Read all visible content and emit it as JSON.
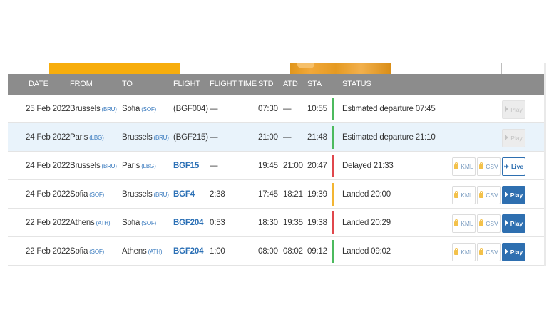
{
  "headers": [
    "DATE",
    "FROM",
    "TO",
    "FLIGHT",
    "FLIGHT TIME",
    "STD",
    "ATD",
    "STA",
    "STATUS"
  ],
  "rows": [
    {
      "date": "25 Feb 2022",
      "from": "Brussels",
      "from_code": "(BRU)",
      "to": "Sofia",
      "to_code": "(SOF)",
      "flight": "(BGF004)",
      "flight_link": false,
      "flight_time": "—",
      "std": "07:30",
      "atd": "—",
      "sta": "10:55",
      "status": "Estimated departure 07:45",
      "status_color": "#4cba5e",
      "kml": "",
      "csv": "",
      "action": "Play",
      "action_type": "disabled",
      "highlight": false
    },
    {
      "date": "24 Feb 2022",
      "from": "Paris",
      "from_code": "(LBG)",
      "to": "Brussels",
      "to_code": "(BRU)",
      "flight": "(BGF215)",
      "flight_link": false,
      "flight_time": "—",
      "std": "21:00",
      "atd": "—",
      "sta": "21:48",
      "status": "Estimated departure 21:10",
      "status_color": "#4cba5e",
      "kml": "",
      "csv": "",
      "action": "Play",
      "action_type": "disabled",
      "highlight": true
    },
    {
      "date": "24 Feb 2022",
      "from": "Brussels",
      "from_code": "(BRU)",
      "to": "Paris",
      "to_code": "(LBG)",
      "flight": "BGF15",
      "flight_link": true,
      "flight_time": "—",
      "std": "19:45",
      "atd": "21:00",
      "sta": "20:47",
      "status": "Delayed 21:33",
      "status_color": "#e0474c",
      "kml": "KML",
      "csv": "CSV",
      "action": "Live",
      "action_type": "live",
      "highlight": false
    },
    {
      "date": "24 Feb 2022",
      "from": "Sofia",
      "from_code": "(SOF)",
      "to": "Brussels",
      "to_code": "(BRU)",
      "flight": "BGF4",
      "flight_link": true,
      "flight_time": "2:38",
      "std": "17:45",
      "atd": "18:21",
      "sta": "19:39",
      "status": "Landed 20:00",
      "status_color": "#f3b532",
      "kml": "KML",
      "csv": "CSV",
      "action": "Play",
      "action_type": "play",
      "highlight": false
    },
    {
      "date": "22 Feb 2022",
      "from": "Athens",
      "from_code": "(ATH)",
      "to": "Sofia",
      "to_code": "(SOF)",
      "flight": "BGF204",
      "flight_link": true,
      "flight_time": "0:53",
      "std": "18:30",
      "atd": "19:35",
      "sta": "19:38",
      "status": "Landed 20:29",
      "status_color": "#e0474c",
      "kml": "KML",
      "csv": "CSV",
      "action": "Play",
      "action_type": "play",
      "highlight": false
    },
    {
      "date": "22 Feb 2022",
      "from": "Sofia",
      "from_code": "(SOF)",
      "to": "Athens",
      "to_code": "(ATH)",
      "flight": "BGF204",
      "flight_link": true,
      "flight_time": "1:00",
      "std": "08:00",
      "atd": "08:02",
      "sta": "09:12",
      "status": "Landed 09:02",
      "status_color": "#4cba5e",
      "kml": "KML",
      "csv": "CSV",
      "action": "Play",
      "action_type": "play",
      "highlight": false
    }
  ],
  "colors": {
    "header_bg": "#8c8c8c",
    "link": "#2a6fb5",
    "play_bg": "#2e6fb0",
    "row_highlight": "#e9f3fb"
  }
}
